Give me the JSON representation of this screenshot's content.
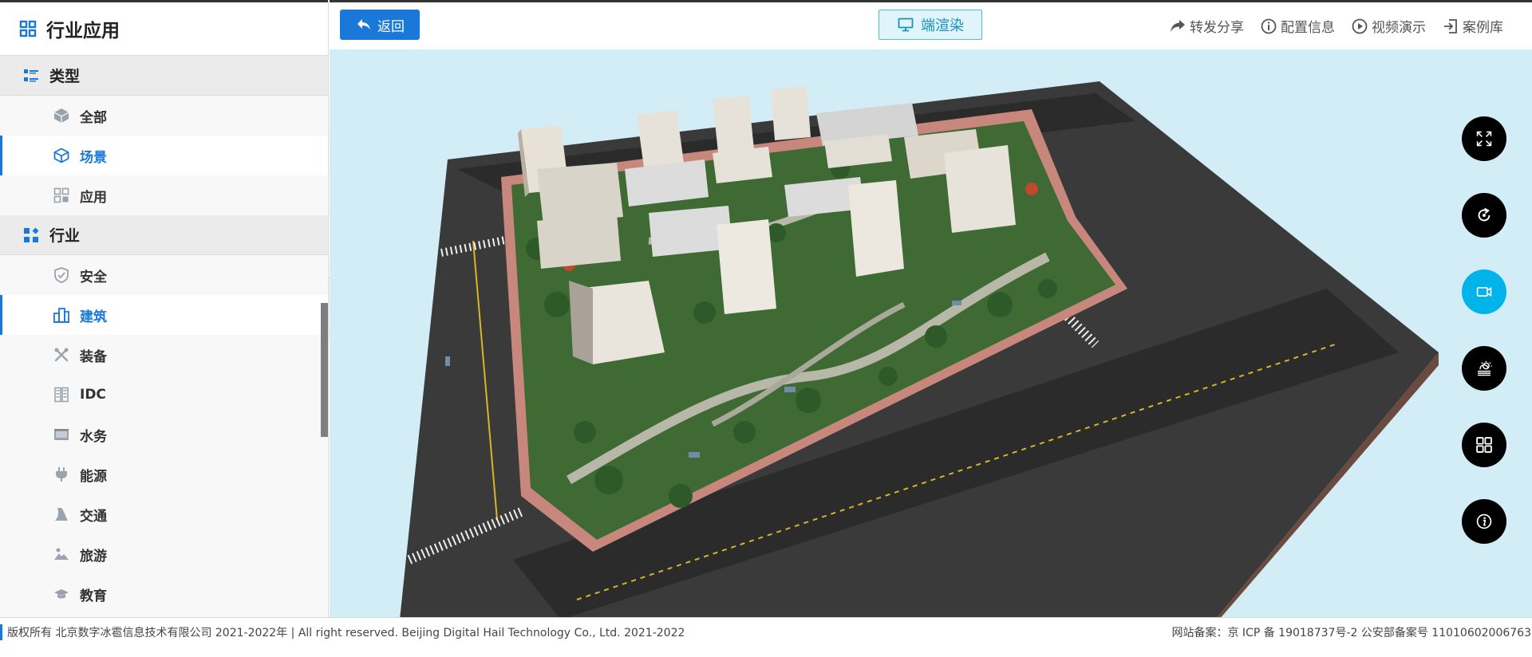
{
  "sidebar": {
    "title": "行业应用",
    "sections": [
      {
        "title": "类型",
        "items": [
          {
            "label": "全部"
          },
          {
            "label": "场景"
          },
          {
            "label": "应用"
          }
        ]
      },
      {
        "title": "行业",
        "items": [
          {
            "label": "安全"
          },
          {
            "label": "建筑"
          },
          {
            "label": "装备"
          },
          {
            "label": "IDC"
          },
          {
            "label": "水务"
          },
          {
            "label": "能源"
          },
          {
            "label": "交通"
          },
          {
            "label": "旅游"
          },
          {
            "label": "教育"
          }
        ]
      }
    ],
    "active_items": [
      "场景",
      "建筑"
    ]
  },
  "topbar": {
    "back_label": "返回",
    "render_label": "端渲染",
    "actions": [
      {
        "label": "转发分享"
      },
      {
        "label": "配置信息"
      },
      {
        "label": "视频演示"
      },
      {
        "label": "案例库"
      }
    ]
  },
  "colors": {
    "accent": "#1a79d8",
    "viewport_bg": "#d2edf5",
    "tool_active": "#00b4ea"
  },
  "footer": {
    "copyright": "版权所有 北京数字冰雹信息技术有限公司 2021-2022年 | All right reserved. Beijing Digital Hail Technology Co., Ltd. 2021-2022",
    "icp": "网站备案：京 ICP 备 19018737号-2 公安部备案号 11010602006763"
  }
}
